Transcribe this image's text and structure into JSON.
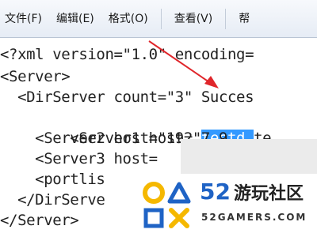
{
  "menu": {
    "items": [
      "文件(F)",
      "编辑(E)",
      "格式(O)",
      "查看(V)",
      "帮"
    ]
  },
  "editor": {
    "lines": [
      "<?xml version=\"1.0\" encoding=",
      "<Server>",
      "  <DirServer count=\"3\" Succes",
      "    <Server1 host=\"",
      "    <Server2 host=\"192.7.9",
      "    <Server3 host=",
      "    <portlis",
      "  </DirServe",
      "</Server>"
    ],
    "selected_text": "testd.",
    "after_selection": "te"
  },
  "watermark": {
    "brand_number": "52",
    "brand_name": "游玩社区",
    "url": "52GAMERS.COM"
  },
  "colors": {
    "selection": "#3399ff",
    "arrow": "#e0262b",
    "logo_yellow": "#f5b800",
    "logo_blue": "#1f63c5"
  }
}
